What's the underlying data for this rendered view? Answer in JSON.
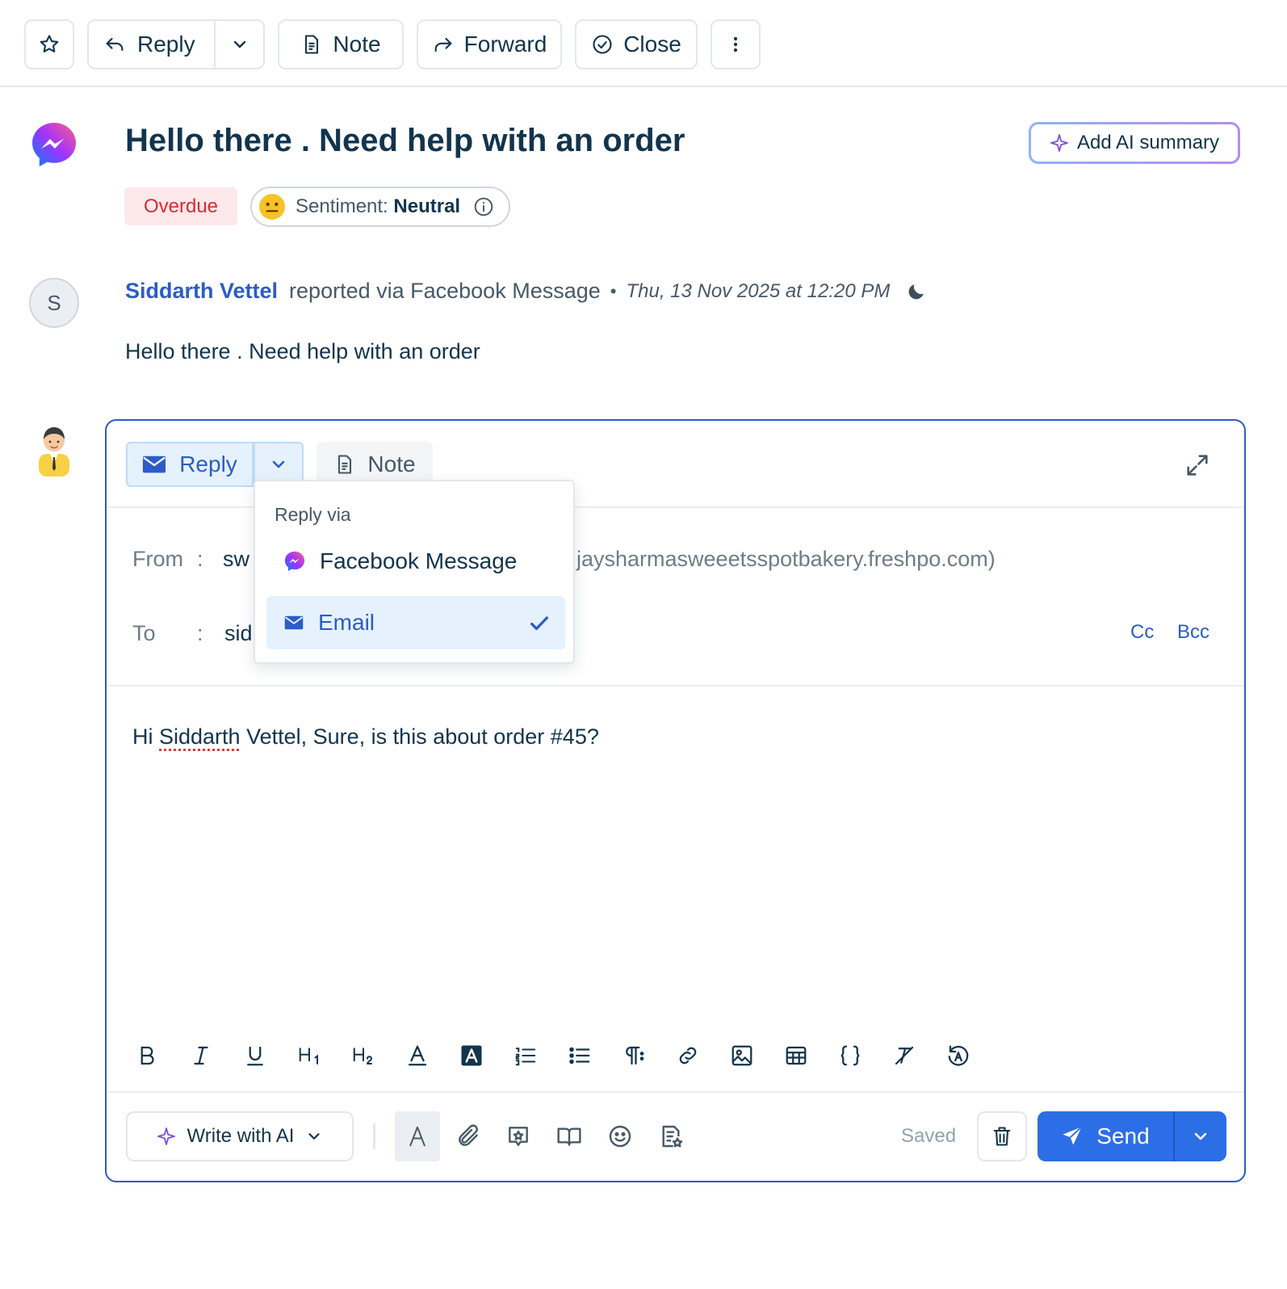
{
  "toolbar": {
    "reply_label": "Reply",
    "note_label": "Note",
    "forward_label": "Forward",
    "close_label": "Close"
  },
  "ticket": {
    "title": "Hello there . Need help with an order",
    "ai_summary_label": "Add AI summary",
    "overdue_label": "Overdue",
    "sentiment_label": "Sentiment:",
    "sentiment_value": "Neutral"
  },
  "message": {
    "avatar_initial": "S",
    "author": "Siddarth Vettel",
    "via": "reported via Facebook Message",
    "separator": "•",
    "timestamp": "Thu, 13 Nov 2025 at 12:20 PM",
    "body": "Hello there . Need help with an order"
  },
  "composer": {
    "reply_tab": "Reply",
    "note_tab": "Note",
    "from_label": "From",
    "to_label": "To",
    "colon": ":",
    "from_value_visible": "sw",
    "from_address_visible": "jaysharmasweeetsspotbakery.freshpo.com)",
    "to_value_visible": "sid",
    "cc_label": "Cc",
    "bcc_label": "Bcc",
    "body_greeting": "Hi ",
    "body_name": "Siddarth",
    "body_rest": " Vettel, Sure, is this about order #45?",
    "write_ai_label": "Write with AI",
    "saved_label": "Saved",
    "send_label": "Send"
  },
  "reply_via_menu": {
    "heading": "Reply via",
    "options": [
      {
        "label": "Facebook Message",
        "icon": "messenger-icon",
        "selected": false
      },
      {
        "label": "Email",
        "icon": "envelope-icon",
        "selected": true
      }
    ]
  },
  "colors": {
    "accent": "#2c5cc5",
    "send": "#2c6ee6",
    "overdue_bg": "#fde8ea",
    "overdue_text": "#d72d30",
    "selected_bg": "#e5f2fd"
  }
}
